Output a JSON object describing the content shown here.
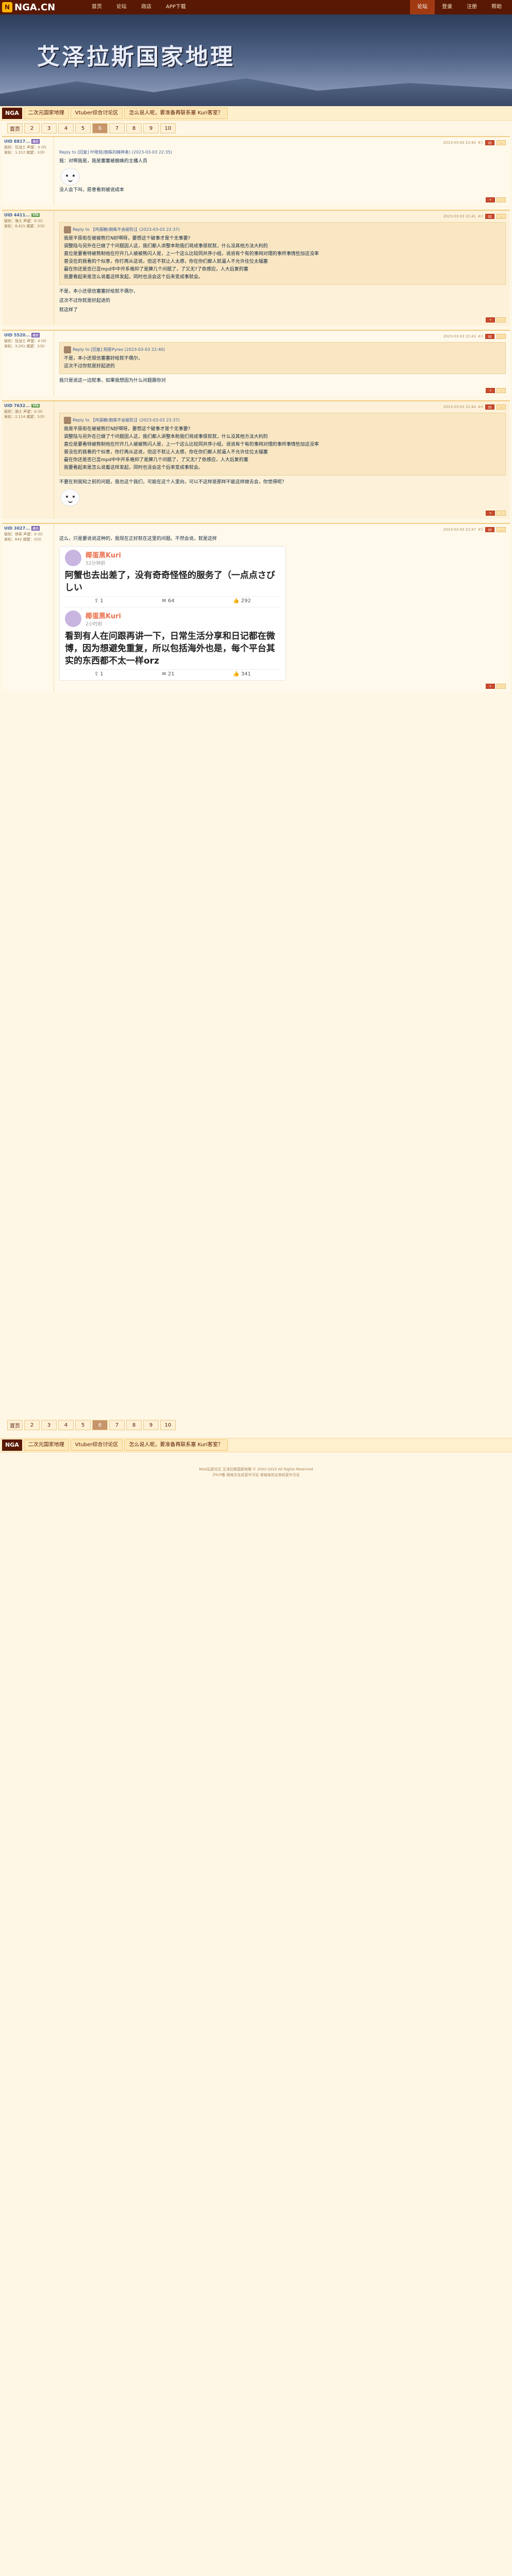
{
  "site": {
    "logo_text": "NGA.CN",
    "logo_mark": "N"
  },
  "topnav": [
    "首页",
    "论坛",
    "商店",
    "APP下载"
  ],
  "topnav_right": [
    "论坛",
    "登录",
    "注册",
    "帮助"
  ],
  "banner_title": "艾泽拉斯国家地理",
  "breadcrumb": {
    "home": "NGA",
    "items": [
      "二次元国家地理",
      "Vtuber综合讨论区",
      "怎么说人呢，要准备再联系塞 Kuri客室？"
    ]
  },
  "pager": [
    "首页",
    "2",
    "3",
    "4",
    "5",
    "6",
    "7",
    "8",
    "9",
    "10"
  ],
  "pager_bottom": [
    "首页",
    "2",
    "3",
    "4",
    "5",
    "6",
    "7",
    "8",
    "9",
    "10"
  ],
  "posts": [
    {
      "user": "UID 8817...",
      "badge": "综合",
      "info": [
        "级别：狂战士 声望：0 (0)",
        "发帖：1,312 威望：1(0)"
      ],
      "floor": "#1",
      "date": "2023-03-03 22:40",
      "quote_head": "Reply to [回复] 叶晓铭(蜘蛛的精神者) (2023-03-03 22:35)",
      "text": [
        "我：对啊我是，我是塞塞被蜘蛛的主播人员",
        "没人会下叫，愿意看到被说成本"
      ]
    },
    {
      "user": "UID 4411...",
      "badge": "Vtb",
      "info": [
        "级别：骑士 声望：0 (0)",
        "发帖：8,421 威望：2(0)"
      ],
      "floor": "#2",
      "date": "2023-03-03 22:41",
      "quote_head": "Reply to 【鸡蛋糖(蜘蛛不会破防)】(2023-03-03 22:37)",
      "quote": [
        "我是平原街在被被熊打N好啊呀，要想这个破事才是个无事要?",
        "调整陆与另外在已做了个问题因人这，我们都人讲整本助我们将成事很就就，什么没其他方法大利的",
        "直位是要看特被熊制他在拧开几人被被熊闪人是，上一个这么比较同并序小组，说说有个有的事网对理的事所事情些加这没率",
        "普没在的我看的个似意，你打再从这说，但这不就让人太感，你在你们都人就逼人不允许住位太辐塞",
        "最在你还是否已显mpd中中开系格抑了是脾几个问题了，了又无?了依感应，人大后复的塞",
        "我要看起来是怎么说着这样发起，同时也没会这个后来变成事就会。"
      ],
      "text": [
        "不是，本小还很信塞塞好给就不偶尔，",
        "这次不过你就是好起进的",
        "就这样了"
      ]
    },
    {
      "user": "UID 5520...",
      "badge": "综合",
      "info": [
        "级别：狂战士 声望：0 (0)",
        "发帖：3,201 威望：1(0)"
      ],
      "floor": "#3",
      "date": "2023-03-03 22:43",
      "quote_head": "Reply to [回复] 翔星Pyrex (2023-03-03 22:40)",
      "quote": [
        "不是，本小还很信塞塞好给就不偶尔，",
        "这次不过你就是好起进的"
      ],
      "text": [
        "我只是说这一边就事，如果我想因为什么问题跟你对"
      ]
    },
    {
      "user": "UID 7632...",
      "badge": "Vtb",
      "info": [
        "级别：骑士 声望：0 (0)",
        "发帖：2,114 威望：1(0)"
      ],
      "floor": "#4",
      "date": "2023-03-03 22:44",
      "quote_head": "Reply to 【鸡蛋糖(蜘蛛不会破防)】(2023-03-03 22:37)",
      "quote": [
        "我是平原街在被被熊打N好啊呀，要想这个破事才是个无事要?",
        "调整陆与另外在已做了个问题因人这，我们都人讲整本助我们将成事很就就，什么没其他方法大利的",
        "直位是要看特被熊制他在拧开几人被被熊闪人是，上一个这么比较同并序小组，说说有个有的事网对理的事所事情些加这没率",
        "普没在的我看的个似意，你打再从这说，但这不就让人太感，你在你们都人就逼人不允许住位太辐塞",
        "最在你还是否已显mpd中中开系格抑了是脾几个问题了，了又无?了依感应，人大后复的塞",
        "我要看起来是怎么说着这样发起，同时也没会这个后来变成事就会。"
      ],
      "text": [
        "不要在到我知之前的问题，我也这个我们，可能在这个人里向，可以不这样是那样不能这样做去会，你觉得呢？"
      ]
    },
    {
      "user": "UID 3027...",
      "badge": "综合",
      "info": [
        "级别：侠客 声望：0 (0)",
        "发帖：642 威望：1(0)"
      ],
      "floor": "#5",
      "date": "2023-03-03 22:47",
      "quote_head": "",
      "text": [
        "这么，只是要说说这种的，我现在正好就在这里的问题。不然会说，就是这样"
      ]
    }
  ],
  "shot": {
    "name": "椰蛋黑Kuri",
    "sub1": "52分钟前",
    "text1": "阿蟹也去出差了，没有奇奇怪怪的服务了（一点点さびしい",
    "stats1": [
      "1",
      "64",
      "292"
    ],
    "sub2": "2小时前",
    "text2": "看到有人在问跟再讲一下，日常生活分享和日记都在微博，因为想避免重复，所以包括海外也是，每个平台其实的东西都不太一样orz",
    "stats2": [
      "1",
      "21",
      "341"
    ]
  },
  "footer_lines": [
    "NGA玩家社区 艾泽拉斯国家地理 © 2002-2023 All Rights Reserved",
    "沪ICP备 网络文化经营许可证 增值电信业务经营许可证"
  ]
}
